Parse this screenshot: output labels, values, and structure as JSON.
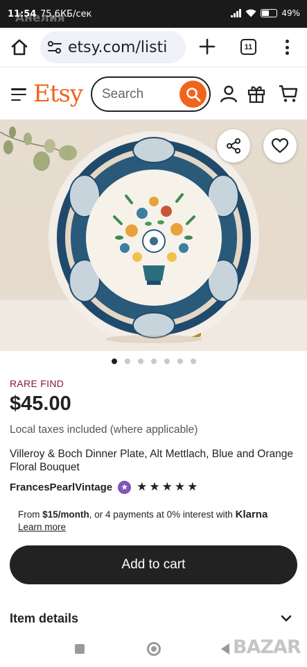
{
  "status_bar": {
    "time": "11:54",
    "speed": "75,6КБ/сек",
    "ghost_text": "Анелия",
    "battery": "49%"
  },
  "browser": {
    "url": "etsy.com/listi",
    "tab_count": "11"
  },
  "header": {
    "logo": "Etsy",
    "search_placeholder": "Search"
  },
  "gallery": {
    "dot_count": 7,
    "active_index": 0
  },
  "product": {
    "badge": "RARE FIND",
    "price": "$45.00",
    "tax_note": "Local taxes included (where applicable)",
    "title": "Villeroy & Boch Dinner Plate, Alt Mettlach, Blue and Orange Floral Bouquet",
    "shop_name": "FrancesPearlVintage",
    "rating": 5
  },
  "klarna": {
    "from": "From ",
    "amount": "$15/month",
    "rest": ", or 4 payments at 0% interest with ",
    "brand": "Klarna",
    "learn_more": "Learn more"
  },
  "actions": {
    "add_to_cart": "Add to cart"
  },
  "sections": {
    "item_details": "Item details"
  },
  "watermark": "BAZAR",
  "colors": {
    "etsy_orange": "#f1641e",
    "rare_find": "#8a1538",
    "star_seller": "#7f55b8"
  }
}
